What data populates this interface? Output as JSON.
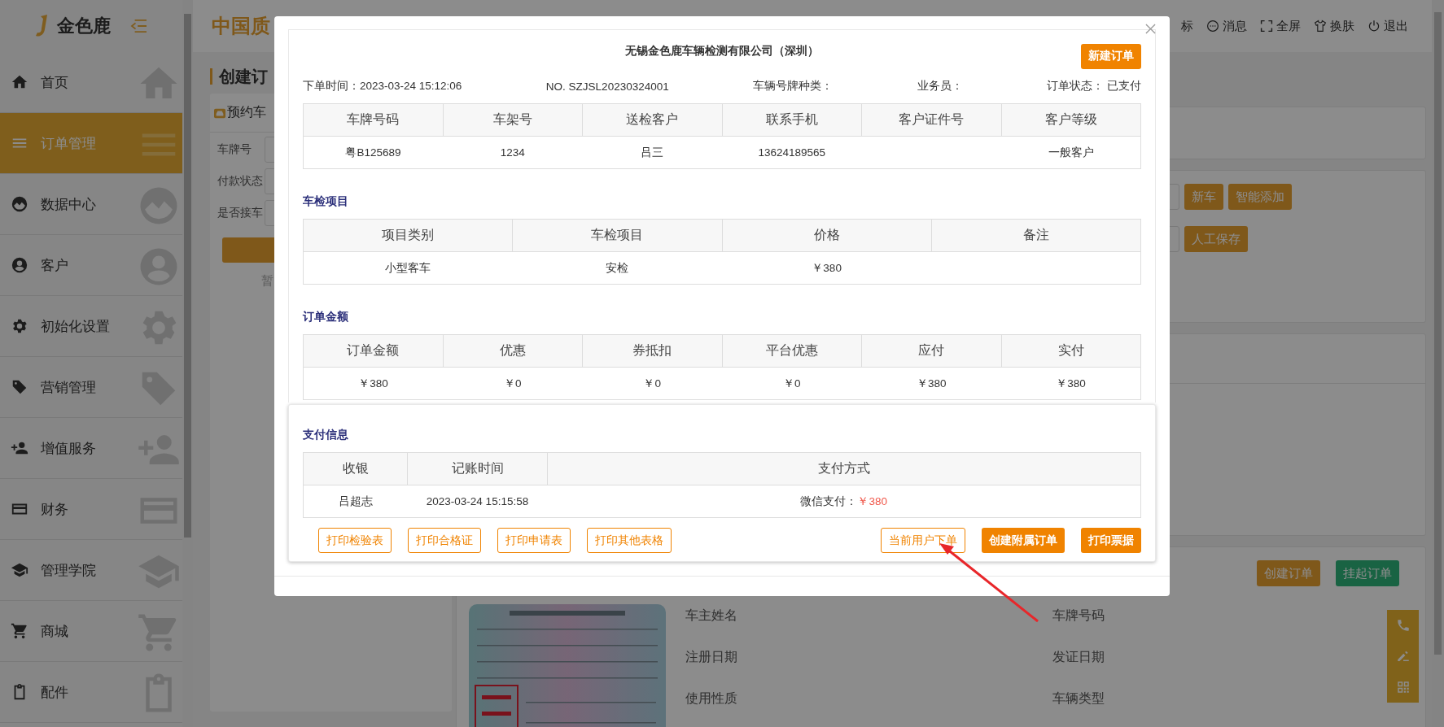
{
  "logo": {
    "name": "金色鹿"
  },
  "sidebar": {
    "items": [
      {
        "label": "首页",
        "kind": "home",
        "selected": false
      },
      {
        "label": "订单管理",
        "kind": "list",
        "selected": true
      },
      {
        "label": "数据中心",
        "kind": "chart",
        "selected": false
      },
      {
        "label": "客户",
        "kind": "user",
        "selected": false
      },
      {
        "label": "初始化设置",
        "kind": "gear",
        "selected": false
      },
      {
        "label": "营销管理",
        "kind": "tag",
        "selected": false
      },
      {
        "label": "增值服务",
        "kind": "useradd",
        "selected": false
      },
      {
        "label": "财务",
        "kind": "card",
        "selected": false
      },
      {
        "label": "管理学院",
        "kind": "cap",
        "selected": false
      },
      {
        "label": "商城",
        "kind": "cart",
        "selected": false
      },
      {
        "label": "配件",
        "kind": "clipboard",
        "selected": false
      }
    ]
  },
  "header": {
    "title": "中国质",
    "actions": [
      {
        "label": "标",
        "kind": "none"
      },
      {
        "label": "消息",
        "kind": "chat"
      },
      {
        "label": "全屏",
        "kind": "expand"
      },
      {
        "label": "换肤",
        "kind": "shirt"
      },
      {
        "label": "退出",
        "kind": "power"
      }
    ]
  },
  "page_title": "创建订",
  "booking_panel": {
    "title": "预约车",
    "fields": [
      "车牌号",
      "付款状态",
      "是否接车"
    ],
    "empty_text": "暂"
  },
  "vehicle_panel": {
    "rows": [
      [
        "新车",
        "智能添加"
      ],
      [
        "人工保存"
      ]
    ]
  },
  "order_panel": {
    "buttons": [
      {
        "label": "创建订单",
        "kind": "primary"
      },
      {
        "label": "挂起订单",
        "kind": "success"
      }
    ],
    "fields": [
      [
        "车主姓名",
        "车牌号码"
      ],
      [
        "注册日期",
        "发证日期"
      ],
      [
        "使用性质",
        "车辆类型"
      ]
    ]
  },
  "dialog": {
    "company": "无锡金色鹿车辆检测有限公司（深圳）",
    "new_order_button": "新建订单",
    "meta": [
      "下单时间：2023-03-24 15:12:06",
      "NO. SZJSL20230324001",
      "车辆号牌种类：",
      "业务员：",
      "订单状态： 已支付"
    ],
    "customer_table": {
      "columns": [
        "车牌号码",
        "车架号",
        "送检客户",
        "联系手机",
        "客户证件号",
        "客户等级"
      ],
      "rows": [
        [
          "粤B125689",
          "1234",
          "吕三",
          "13624189565",
          "",
          "一般客户"
        ]
      ]
    },
    "inspection": {
      "title": "车检项目",
      "columns": [
        "项目类别",
        "车检项目",
        "价格",
        "备注"
      ],
      "rows": [
        [
          "小型客车",
          "安检",
          "￥380",
          ""
        ]
      ]
    },
    "amount": {
      "title": "订单金额",
      "columns": [
        "订单金额",
        "优惠",
        "券抵扣",
        "平台优惠",
        "应付",
        "实付"
      ],
      "rows": [
        [
          "￥380",
          "￥0",
          "￥0",
          "￥0",
          "￥380",
          "￥380"
        ]
      ]
    },
    "payment": {
      "title": "支付信息",
      "columns": [
        "收银",
        "记账时间",
        "支付方式"
      ],
      "rows": [
        {
          "cashier": "吕超志",
          "time": "2023-03-24 15:15:58",
          "method": "微信支付：",
          "amount": "￥380"
        }
      ]
    },
    "print_buttons": [
      "打印检验表",
      "打印合格证",
      "打印申请表",
      "打印其他表格"
    ],
    "action_buttons": [
      {
        "label": "当前用户下单",
        "kind": "outline"
      },
      {
        "label": "创建附属订单",
        "kind": "solid"
      },
      {
        "label": "打印票据",
        "kind": "solid"
      }
    ]
  }
}
